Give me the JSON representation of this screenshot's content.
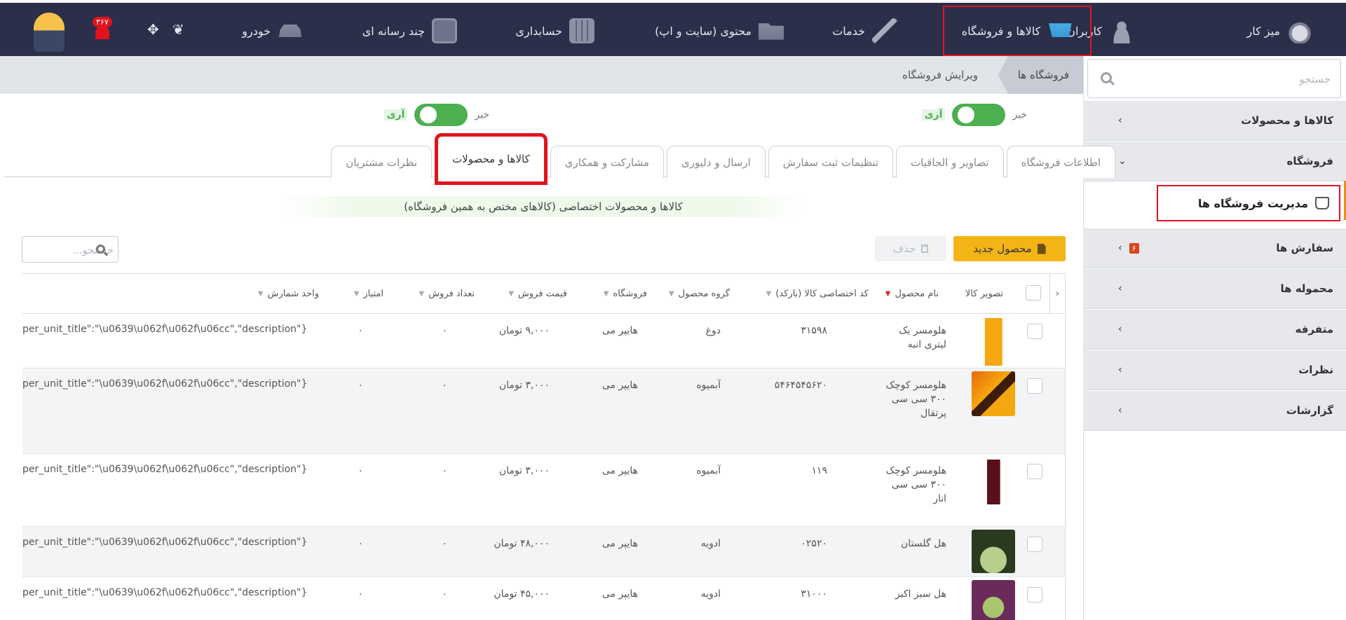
{
  "topbar": {
    "items": [
      {
        "label": "میز کار",
        "icon": "gauge-icon"
      },
      {
        "label": "کاربران",
        "icon": "users-icon"
      },
      {
        "label": "کالاها و فروشگاه",
        "icon": "cart-icon"
      },
      {
        "label": "خدمات",
        "icon": "brush-icon"
      },
      {
        "label": "محتوی (سایت و اپ)",
        "icon": "folder-icon"
      },
      {
        "label": "حسابداری",
        "icon": "calculator-icon"
      },
      {
        "label": "چند رسانه ای",
        "icon": "media-icon"
      },
      {
        "label": "خودرو",
        "icon": "car-icon"
      }
    ],
    "notification_count": "۳۶۷",
    "accent": "#e0131f"
  },
  "breadcrumb": {
    "store": "فروشگاه ها",
    "edit": "ویرایش فروشگاه"
  },
  "sidebar": {
    "search_placeholder": "جستجو",
    "items": [
      {
        "label": "کالاها و محصولات",
        "chevron": "›"
      },
      {
        "label": "فروشگاه",
        "chevron": "⌄"
      },
      {
        "label": "سفارش ها",
        "chevron": "›",
        "badge": "۶"
      },
      {
        "label": "محموله ها",
        "chevron": "›"
      },
      {
        "label": "متفرقه",
        "chevron": "›"
      },
      {
        "label": "نظرات",
        "chevron": "›"
      },
      {
        "label": "گزارشات",
        "chevron": "›"
      }
    ],
    "sub_item": "مدیریت فروشگاه ها"
  },
  "toggles": [
    {
      "no": "خیر",
      "yes": "آری"
    },
    {
      "no": "خیر",
      "yes": "آری"
    }
  ],
  "tabs": [
    "اطلاعات فروشگاه",
    "تصاویر و الحاقیات",
    "تنظیمات ثبت سفارش",
    "ارسال و دلیوری",
    "مشارکت و همکاری",
    "کالاها و محصولات",
    "نظرات مشتریان"
  ],
  "notice": "کالاها و محصولات اختصاصی (کالاهای مختص به همین فروشگاه)",
  "toolbar": {
    "new_label": "محصول جدید",
    "delete_label": "حذف",
    "search_placeholder": "جستجو..."
  },
  "grid": {
    "columns": [
      "تصویر کالا",
      "نام محصول",
      "کد اختصاصی کالا (بارکد)",
      "گروه محصول",
      "فروشگاه",
      "قیمت فروش",
      "تعداد فروش",
      "امتیاز",
      "واحد شمارش"
    ],
    "rows": [
      {
        "name": "هلومسر یک لیتری انبه",
        "code": "۳۱۵۹۸",
        "group": "دوغ",
        "store": "هایپر می",
        "price": "۹,۰۰۰ تومان",
        "sales": "۰",
        "score": "۰",
        "unit": "per_unit_title\":\"\\u0639\\u062f\\u062f\\u06cc\",\"description\"}"
      },
      {
        "name": "هلومسر کوچک ۳۰۰ سی سی پرتقال",
        "code": "۵۴۶۴۵۴۵۶۲۰",
        "group": "آبمیوه",
        "store": "هایپر می",
        "price": "۳,۰۰۰ تومان",
        "sales": "۰",
        "score": "۰",
        "unit": "per_unit_title\":\"\\u0639\\u062f\\u062f\\u06cc\",\"description\"}"
      },
      {
        "name": "هلومسر کوچک ۳۰۰ سی سی انار",
        "code": "۱۱۹",
        "group": "آبمیوه",
        "store": "هایپر می",
        "price": "۳,۰۰۰ تومان",
        "sales": "۰",
        "score": "۰",
        "unit": "per_unit_title\":\"\\u0639\\u062f\\u062f\\u06cc\",\"description\"}"
      },
      {
        "name": "هل گلستان",
        "code": "۰۲۵۲۰",
        "group": "ادویه",
        "store": "هایپر می",
        "price": "۴۸,۰۰۰ تومان",
        "sales": "۰",
        "score": "۰",
        "unit": "per_unit_title\":\"\\u0639\\u062f\\u062f\\u06cc\",\"description\"}"
      },
      {
        "name": "هل سبز اکبر",
        "code": "۳۱۰۰۰",
        "group": "ادویه",
        "store": "هایپر می",
        "price": "۴۵,۰۰۰ تومان",
        "sales": "۰",
        "score": "۰",
        "unit": "per_unit_title\":\"\\u0639\\u062f\\u062f\\u06cc\",\"description\"}"
      }
    ]
  }
}
